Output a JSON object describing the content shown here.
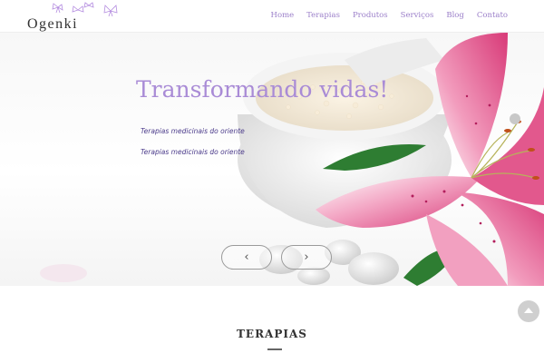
{
  "header": {
    "logo_text": "Ogenki",
    "nav": [
      "Home",
      "Terapias",
      "Produtos",
      "Serviços",
      "Blog",
      "Contato"
    ]
  },
  "hero": {
    "headline": "Transformando vidas!",
    "subtitle_1": "Terapias medicinais do oriente",
    "subtitle_2": "Terapias medicinais do oriente",
    "prev_icon": "chevron-left-icon",
    "next_icon": "chevron-right-icon"
  },
  "section": {
    "title": "TERAPIAS"
  },
  "colors": {
    "accent": "#9b7fc9",
    "headline": "#a98bd6",
    "subtitle": "#4a3a8a",
    "flower_pink": "#e2588d"
  }
}
